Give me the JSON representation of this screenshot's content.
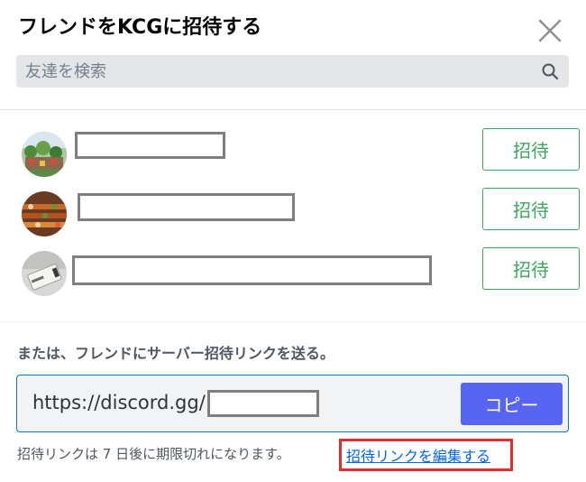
{
  "modal": {
    "title": "フレンドをKCGに招待する"
  },
  "search": {
    "placeholder": "友達を検索"
  },
  "friends": [
    {
      "invite_label": "招待"
    },
    {
      "invite_label": "招待"
    },
    {
      "invite_label": "招待"
    }
  ],
  "invite_link": {
    "section_label": "または、フレンドにサーバー招待リンクを送る。",
    "url_prefix": "https://discord.gg/",
    "copy_label": "コピー",
    "expiry_text": "招待リンクは 7 日後に期限切れになります。",
    "edit_link_label": "招待リンクを編集する"
  },
  "colors": {
    "accent": "#5865f2",
    "invite_green": "#3ba55d",
    "link_blue": "#0068e0",
    "highlight_red": "#e12d2d"
  }
}
